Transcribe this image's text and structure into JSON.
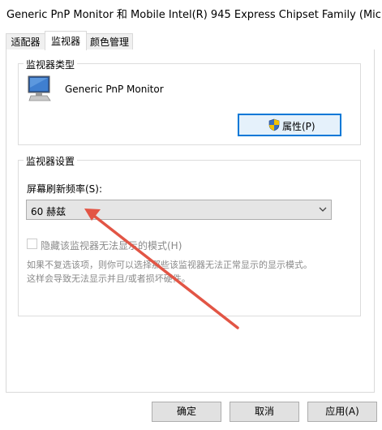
{
  "window": {
    "title": "Generic PnP Monitor 和 Mobile Intel(R) 945 Express Chipset Family (Mic..."
  },
  "tabs": [
    {
      "label": "适配器",
      "active": false
    },
    {
      "label": "监视器",
      "active": true
    },
    {
      "label": "颜色管理",
      "active": false
    }
  ],
  "monitor_type": {
    "group_label": "监视器类型",
    "icon": "monitor-icon",
    "name": "Generic PnP Monitor",
    "properties_button": "属性(P)",
    "properties_icon": "uac-shield-icon"
  },
  "monitor_settings": {
    "group_label": "监视器设置",
    "refresh_label": "屏幕刷新频率(S):",
    "refresh_value": "60 赫兹",
    "hide_modes_label": "隐藏该监视器无法显示的模式(H)",
    "hide_modes_checked": false,
    "description_line1": "如果不复选该项，则你可以选择那些该监视器无法正常显示的显示模式。",
    "description_line2": "这样会导致无法显示并且/或者损坏硬件。"
  },
  "footer": {
    "ok": "确定",
    "cancel": "取消",
    "apply": "应用(A)"
  },
  "colors": {
    "accent": "#0078d7",
    "annotation_arrow": "#e25545",
    "disabled_text": "#8a8a8a"
  }
}
